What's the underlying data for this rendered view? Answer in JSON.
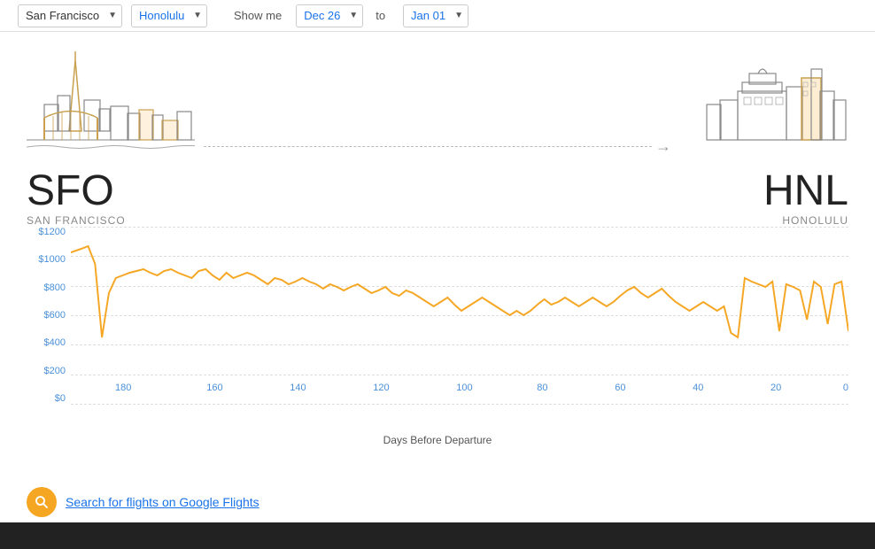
{
  "header": {
    "origin_city": "San Francisco",
    "destination_city": "Honolulu",
    "show_me_label": "Show me",
    "date_from": "Dec 26",
    "to_label": "to",
    "date_to": "Jan 01"
  },
  "cities": {
    "origin_code": "SFO",
    "origin_name": "SAN FRANCISCO",
    "destination_code": "HNL",
    "destination_name": "HONOLULU"
  },
  "chart": {
    "y_labels": [
      "$1200",
      "$1000",
      "$800",
      "$600",
      "$400",
      "$200",
      "$0"
    ],
    "x_labels": [
      "180",
      "160",
      "140",
      "120",
      "100",
      "80",
      "60",
      "40",
      "20",
      "0"
    ],
    "x_axis_title": "Days Before Departure"
  },
  "search": {
    "link_text": "Search for flights on Google Flights"
  }
}
